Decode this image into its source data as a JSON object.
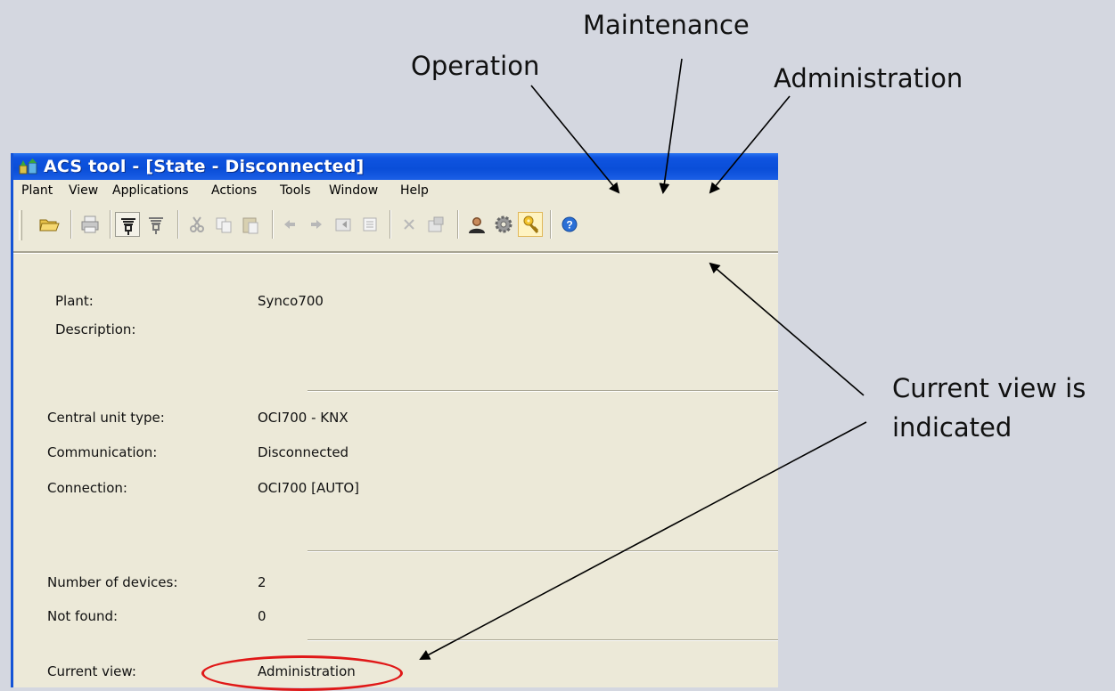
{
  "callouts": {
    "maintenance": "Maintenance",
    "operation": "Operation",
    "administration": "Administration",
    "current_view_note_line1": "Current view is",
    "current_view_note_line2": "indicated"
  },
  "window": {
    "title": "ACS tool - [State - Disconnected]",
    "menu": [
      "Plant",
      "View",
      "Applications",
      "Actions",
      "Tools",
      "Window",
      "Help"
    ],
    "toolbar_icons": [
      "open-folder-icon",
      "print-icon",
      "connect-icon",
      "disconnect-icon",
      "cut-icon",
      "copy-icon",
      "paste-icon",
      "back-arrow-icon",
      "forward-arrow-icon",
      "import-icon",
      "list-icon",
      "delete-icon",
      "properties-icon",
      "operation-user-icon",
      "maintenance-gear-icon",
      "administration-key-icon",
      "help-icon"
    ]
  },
  "state": {
    "plant_label": "Plant:",
    "plant_value": "Synco700",
    "description_label": "Description:",
    "description_value": "",
    "central_unit_label": "Central unit type:",
    "central_unit_value": "OCI700 - KNX",
    "communication_label": "Communication:",
    "communication_value": "Disconnected",
    "connection_label": "Connection:",
    "connection_value": "OCI700 [AUTO]",
    "devices_label": "Number of devices:",
    "devices_value": "2",
    "not_found_label": "Not found:",
    "not_found_value": "0",
    "current_view_label": "Current view:",
    "current_view_value": "Administration"
  },
  "colors": {
    "titlebar": "#0a4ed8",
    "window_bg": "#ece9d8",
    "page_bg": "#d4d7e0",
    "highlight": "#e01818"
  }
}
